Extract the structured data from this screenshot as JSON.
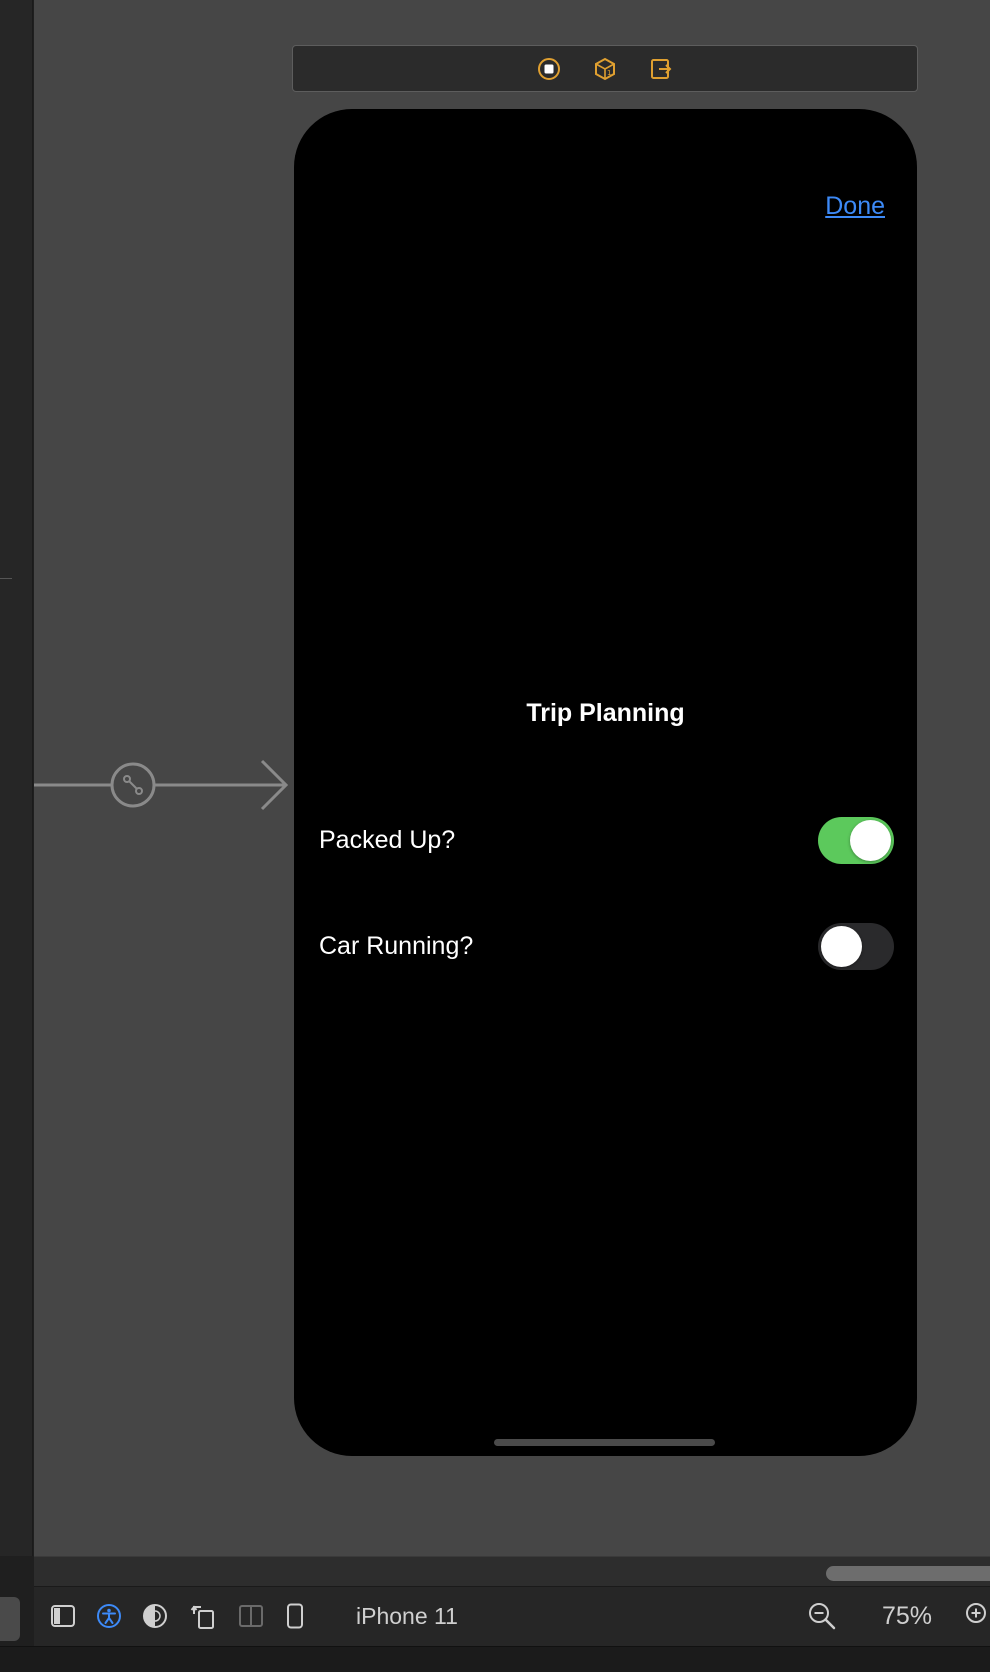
{
  "scene": {
    "nav_done_label": "Done",
    "title": "Trip Planning",
    "rows": [
      {
        "label": "Packed Up?",
        "toggle_on": true
      },
      {
        "label": "Car Running?",
        "toggle_on": false
      }
    ]
  },
  "toolbar": {
    "device_name": "iPhone 11",
    "zoom_level": "75%"
  },
  "colors": {
    "canvas": "#464646",
    "link_blue": "#3d8af7",
    "toggle_on": "#5cc95c",
    "toggle_off": "#2a2a2c",
    "dock_icon_orange": "#e0a030"
  },
  "icons": {
    "dock": [
      "view-controller-icon",
      "first-responder-icon",
      "exit-icon"
    ],
    "toolbar": [
      "navigator-toggle-icon",
      "accessibility-icon",
      "appearance-icon",
      "orientation-icon",
      "layout-split-icon",
      "device-icon",
      "zoom-out-icon",
      "zoom-in-icon"
    ]
  }
}
